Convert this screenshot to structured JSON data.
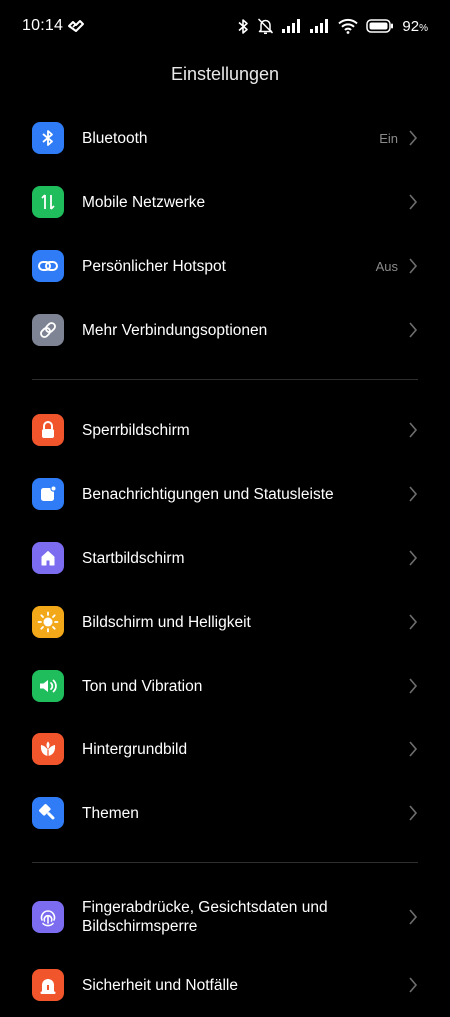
{
  "status_bar": {
    "time": "10:14",
    "battery_percent": "92",
    "battery_suffix": "%"
  },
  "page": {
    "title": "Einstellungen"
  },
  "rows": [
    {
      "label": "Bluetooth",
      "value": "Ein",
      "icon": "bluetooth-icon",
      "color": "#2f7cf6"
    },
    {
      "label": "Mobile Netzwerke",
      "value": "",
      "icon": "mobile-data-icon",
      "color": "#1fbd5b"
    },
    {
      "label": "Persönlicher Hotspot",
      "value": "Aus",
      "icon": "hotspot-link-icon",
      "color": "#2f7cf6"
    },
    {
      "label": "Mehr Verbindungsoptionen",
      "value": "",
      "icon": "connection-link-icon",
      "color": "#7e8494"
    },
    {
      "label": "Sperrbildschirm",
      "value": "",
      "icon": "lock-icon",
      "color": "#f0552c"
    },
    {
      "label": "Benachrichtigungen und Statusleiste",
      "value": "",
      "icon": "notification-icon",
      "color": "#2f7cf6"
    },
    {
      "label": "Startbildschirm",
      "value": "",
      "icon": "home-icon",
      "color": "#7b6cf0"
    },
    {
      "label": "Bildschirm und Helligkeit",
      "value": "",
      "icon": "sun-icon",
      "color": "#f3a81a"
    },
    {
      "label": "Ton und Vibration",
      "value": "",
      "icon": "speaker-icon",
      "color": "#1fbd5b"
    },
    {
      "label": "Hintergrundbild",
      "value": "",
      "icon": "wallpaper-flower-icon",
      "color": "#f0552c"
    },
    {
      "label": "Themen",
      "value": "",
      "icon": "brush-icon",
      "color": "#2f7cf6"
    },
    {
      "label": "Fingerabdrücke, Gesichtsdaten und Bildschirmsperre",
      "label_line1": "Fingerabdrücke, Gesichtsdaten und",
      "label_line2": "Bildschirmsperre",
      "value": "",
      "icon": "fingerprint-icon",
      "color": "#7b6cf0"
    },
    {
      "label": "Sicherheit und Notfälle",
      "value": "",
      "icon": "emergency-icon",
      "color": "#f0552c"
    }
  ]
}
